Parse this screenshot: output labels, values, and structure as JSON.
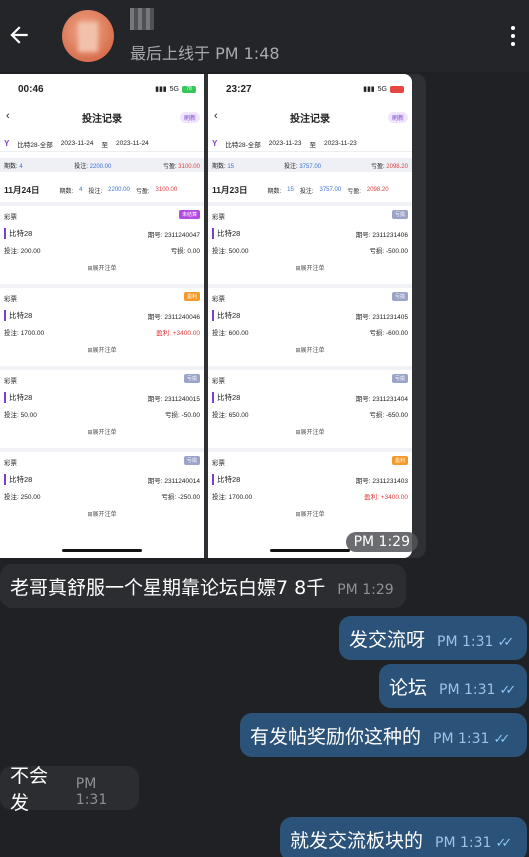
{
  "header": {
    "last_seen": "最后上线于 PM 1:48"
  },
  "image_message": {
    "time": "PM 1:29",
    "left_shot": {
      "status_time": "00:46",
      "net": "5G",
      "battery": "78",
      "battery_color": "#35c759",
      "title": "投注记录",
      "refresh": "刷新",
      "filter_game": "比特28-全部",
      "date_from": "2023-11-24",
      "to": "至",
      "date_to": "2023-11-24",
      "summary": {
        "periods_label": "期数:",
        "periods": "4",
        "bet_label": "投注:",
        "bet": "2200.00",
        "pl_label": "亏盈:",
        "pl": "3100.00"
      },
      "day": {
        "date": "11月24日",
        "periods_label": "期数:",
        "periods": "4",
        "bet_label": "投注:",
        "bet": "2200.00",
        "pl_label": "亏盈:",
        "pl": "3100.00"
      },
      "cards": [
        {
          "cat": "彩票",
          "badge": "未结算",
          "badge_color": "#b44be1",
          "game": "比特28",
          "issue": "期号: 2311240047",
          "bet": "投注: 200.00",
          "res": "亏损: 0.00",
          "res_red": false,
          "expand": "⊞展开注单"
        },
        {
          "cat": "彩票",
          "badge": "盈利",
          "badge_color": "#f39a2b",
          "game": "比特28",
          "issue": "期号: 2311240046",
          "bet": "投注: 1700.00",
          "res": "盈利: +3400.00",
          "res_red": true,
          "expand": "⊞展开注单"
        },
        {
          "cat": "彩票",
          "badge": "亏损",
          "badge_color": "#9aa3c8",
          "game": "比特28",
          "issue": "期号: 2311240015",
          "bet": "投注: 50.00",
          "res": "亏损: -50.00",
          "res_red": false,
          "expand": "⊞展开注单"
        },
        {
          "cat": "彩票",
          "badge": "亏损",
          "badge_color": "#9aa3c8",
          "game": "比特28",
          "issue": "期号: 2311240014",
          "bet": "投注: 250.00",
          "res": "亏损: -250.00",
          "res_red": false,
          "expand": "⊞展开注单"
        }
      ]
    },
    "right_shot": {
      "status_time": "23:27",
      "net": "5G",
      "battery": "",
      "battery_color": "#e84545",
      "title": "投注记录",
      "refresh": "刷新",
      "filter_game": "比特28-全部",
      "date_from": "2023-11-23",
      "to": "至",
      "date_to": "2023-11-23",
      "summary": {
        "periods_label": "期数:",
        "periods": "15",
        "bet_label": "投注:",
        "bet": "3757.00",
        "pl_label": "亏盈:",
        "pl": "2098.20"
      },
      "day": {
        "date": "11月23日",
        "periods_label": "期数:",
        "periods": "15",
        "bet_label": "投注:",
        "bet": "3757.00",
        "pl_label": "亏盈:",
        "pl": "2098.20"
      },
      "cards": [
        {
          "cat": "彩票",
          "badge": "亏损",
          "badge_color": "#9aa3c8",
          "game": "比特28",
          "issue": "期号: 2311231406",
          "bet": "投注: 500.00",
          "res": "亏损: -500.00",
          "res_red": false,
          "expand": "⊞展开注单"
        },
        {
          "cat": "彩票",
          "badge": "亏损",
          "badge_color": "#9aa3c8",
          "game": "比特28",
          "issue": "期号: 2311231405",
          "bet": "投注: 600.00",
          "res": "亏损: -600.00",
          "res_red": false,
          "expand": "⊞展开注单"
        },
        {
          "cat": "彩票",
          "badge": "亏损",
          "badge_color": "#9aa3c8",
          "game": "比特28",
          "issue": "期号: 2311231404",
          "bet": "投注: 650.00",
          "res": "亏损: -650.00",
          "res_red": false,
          "expand": "⊞展开注单"
        },
        {
          "cat": "彩票",
          "badge": "盈利",
          "badge_color": "#f39a2b",
          "game": "比特28",
          "issue": "期号: 2311231403",
          "bet": "投注: 1700.00",
          "res": "盈利: +3400.00",
          "res_red": true,
          "expand": "⊞展开注单"
        }
      ]
    }
  },
  "messages": [
    {
      "dir": "in",
      "text": "老哥真舒服一个星期靠论坛白嫖7 8千",
      "time": "PM 1:29"
    },
    {
      "dir": "out",
      "text": "发交流呀",
      "time": "PM 1:31"
    },
    {
      "dir": "out",
      "text": "论坛",
      "time": "PM 1:31"
    },
    {
      "dir": "out",
      "text": "有发帖奖励你这种的",
      "time": "PM 1:31"
    },
    {
      "dir": "in",
      "text": "不会发",
      "time": "PM 1:31"
    },
    {
      "dir": "out",
      "text": "就发交流板块的",
      "time": "PM 1:31"
    }
  ]
}
